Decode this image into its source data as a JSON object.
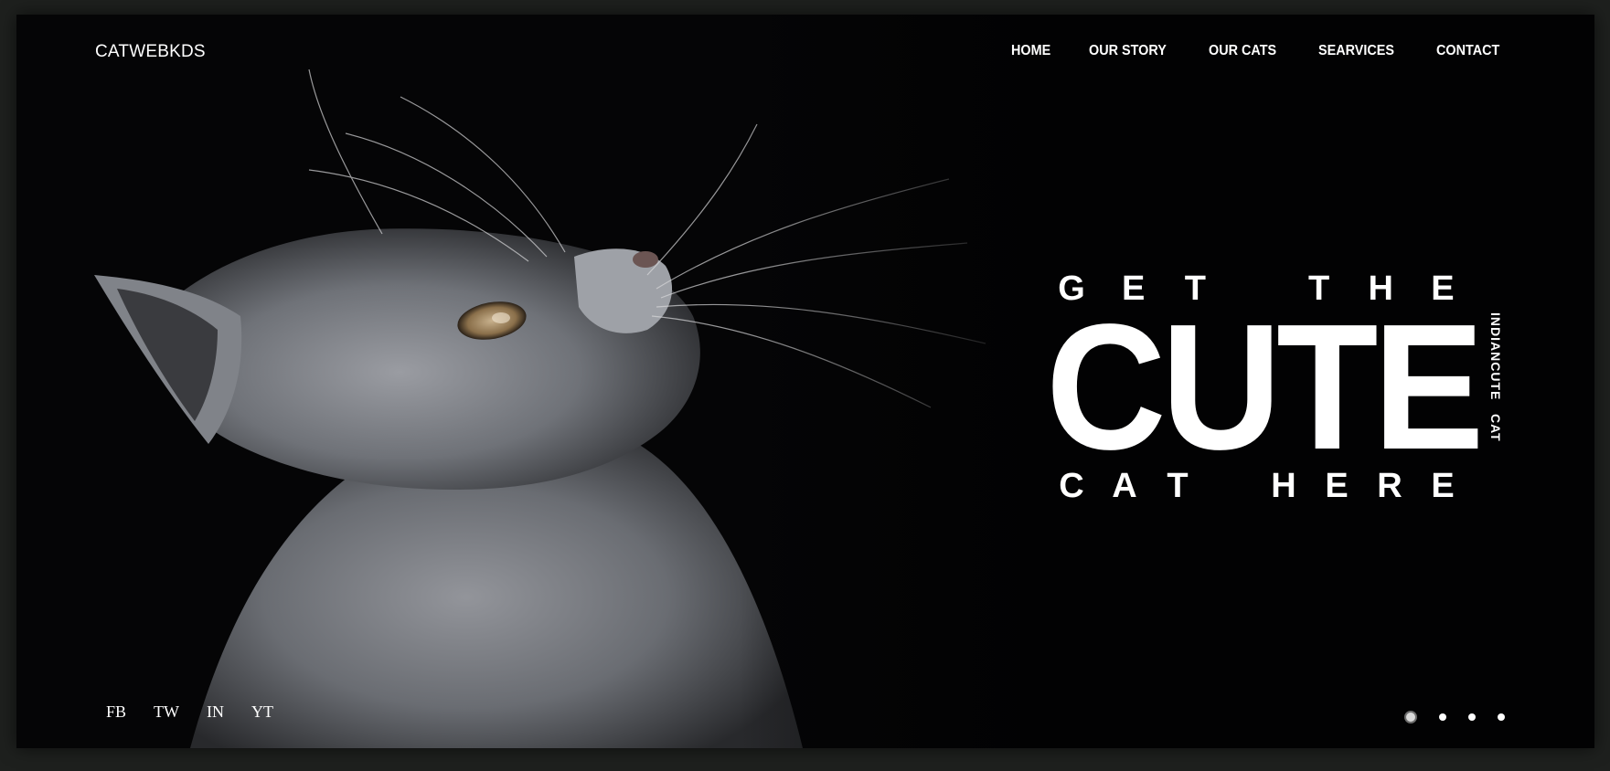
{
  "brand": {
    "name": "CATWEBKDS"
  },
  "nav": {
    "items": [
      "HOME",
      "OUR STORY",
      "OUR CATS",
      "SEARVICES",
      "CONTACT"
    ]
  },
  "hero": {
    "line1": [
      "G",
      "E",
      "T",
      "",
      "T",
      "H",
      "E"
    ],
    "headline": "CUTE",
    "line3": [
      "C",
      "A",
      "T",
      "",
      "H",
      "E",
      "R",
      "E"
    ],
    "side_label": "INDIANCUTE   CAT"
  },
  "social": {
    "items": [
      "FB",
      "TW",
      "IN",
      "YT"
    ]
  },
  "slider": {
    "count": 4,
    "active": 1
  },
  "colors": {
    "background": "#020203",
    "text": "#ffffff",
    "frame": "#1e201e"
  },
  "icons": {
    "hero_image": "cat-photo"
  }
}
